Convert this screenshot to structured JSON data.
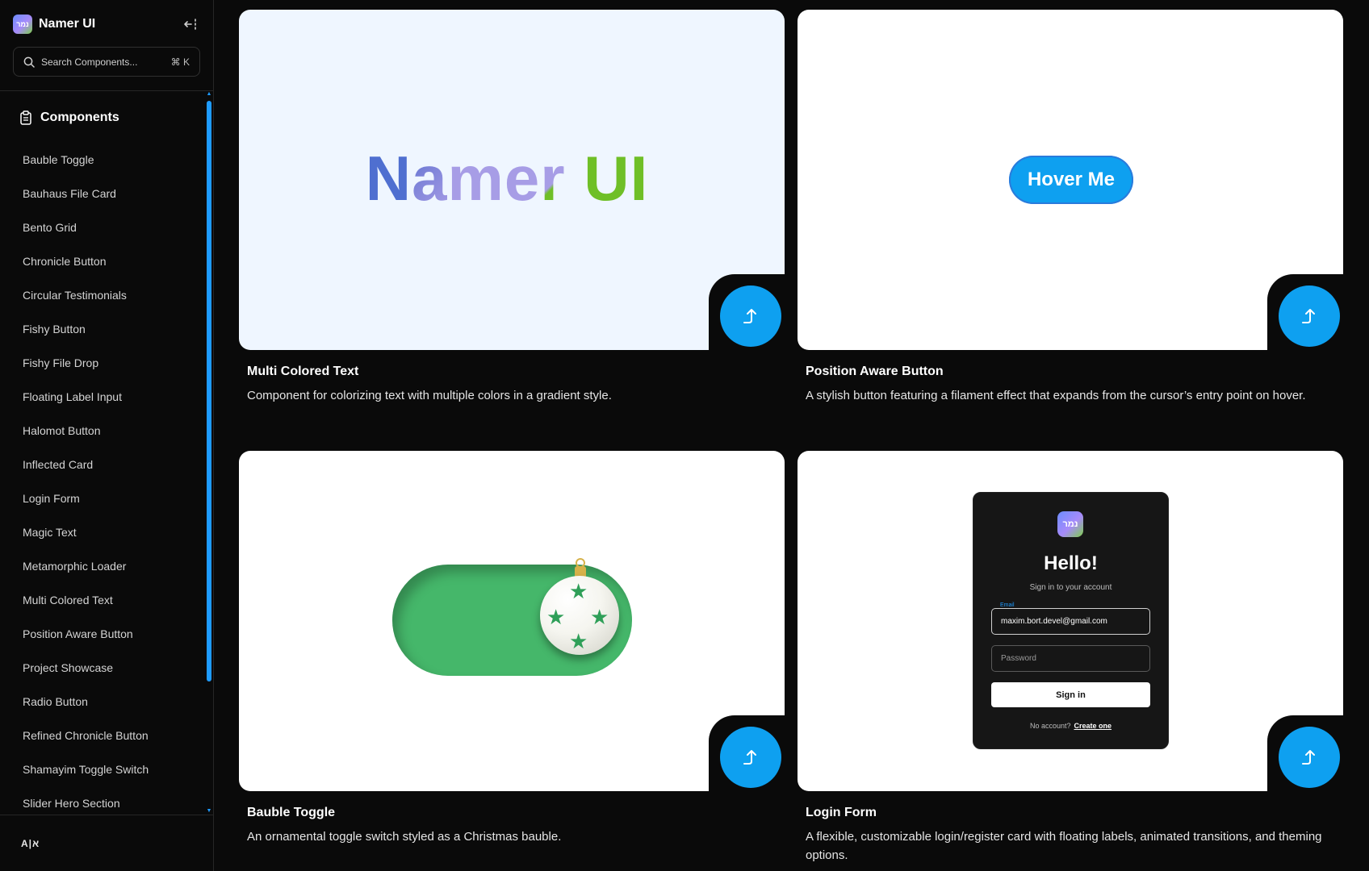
{
  "brand": {
    "name": "Namer UI",
    "logo_text": "נמר"
  },
  "search": {
    "placeholder": "Search Components...",
    "shortcut": "⌘ K"
  },
  "sidebar": {
    "section_title": "Components",
    "items": [
      "Bauble Toggle",
      "Bauhaus File Card",
      "Bento Grid",
      "Chronicle Button",
      "Circular Testimonials",
      "Fishy Button",
      "Fishy File Drop",
      "Floating Label Input",
      "Halomot Button",
      "Inflected Card",
      "Login Form",
      "Magic Text",
      "Metamorphic Loader",
      "Multi Colored Text",
      "Position Aware Button",
      "Project Showcase",
      "Radio Button",
      "Refined Chronicle Button",
      "Shamayim Toggle Switch",
      "Slider Hero Section"
    ],
    "footer_label": "A|א"
  },
  "cards": [
    {
      "title": "Multi Colored Text",
      "description": "Component for colorizing text with multiple colors in a gradient style.",
      "preview": {
        "text_parts": [
          "N",
          "a",
          "me",
          "r",
          " UI"
        ]
      }
    },
    {
      "title": "Position Aware Button",
      "description": "A stylish button featuring a filament effect that expands from the cursor’s entry point on hover.",
      "preview": {
        "button_label": "Hover Me"
      }
    },
    {
      "title": "Bauble Toggle",
      "description": "An ornamental toggle switch styled as a Christmas bauble.",
      "preview": {
        "toggle_on": true
      }
    },
    {
      "title": "Login Form",
      "description": "A flexible, customizable login/register card with floating labels, animated transitions, and theming options.",
      "preview": {
        "logo_text": "נמר",
        "heading": "Hello!",
        "subheading": "Sign in to your account",
        "email_label": "Email",
        "email_value": "maxim.bort.devel@gmail.com",
        "password_placeholder": "Password",
        "button_label": "Sign in",
        "footer_text": "No account?",
        "footer_link": "Create one"
      }
    }
  ],
  "colors": {
    "accent": "#0ea0f0",
    "background": "#0a0a0a",
    "toggle_green": "#45b76a"
  }
}
